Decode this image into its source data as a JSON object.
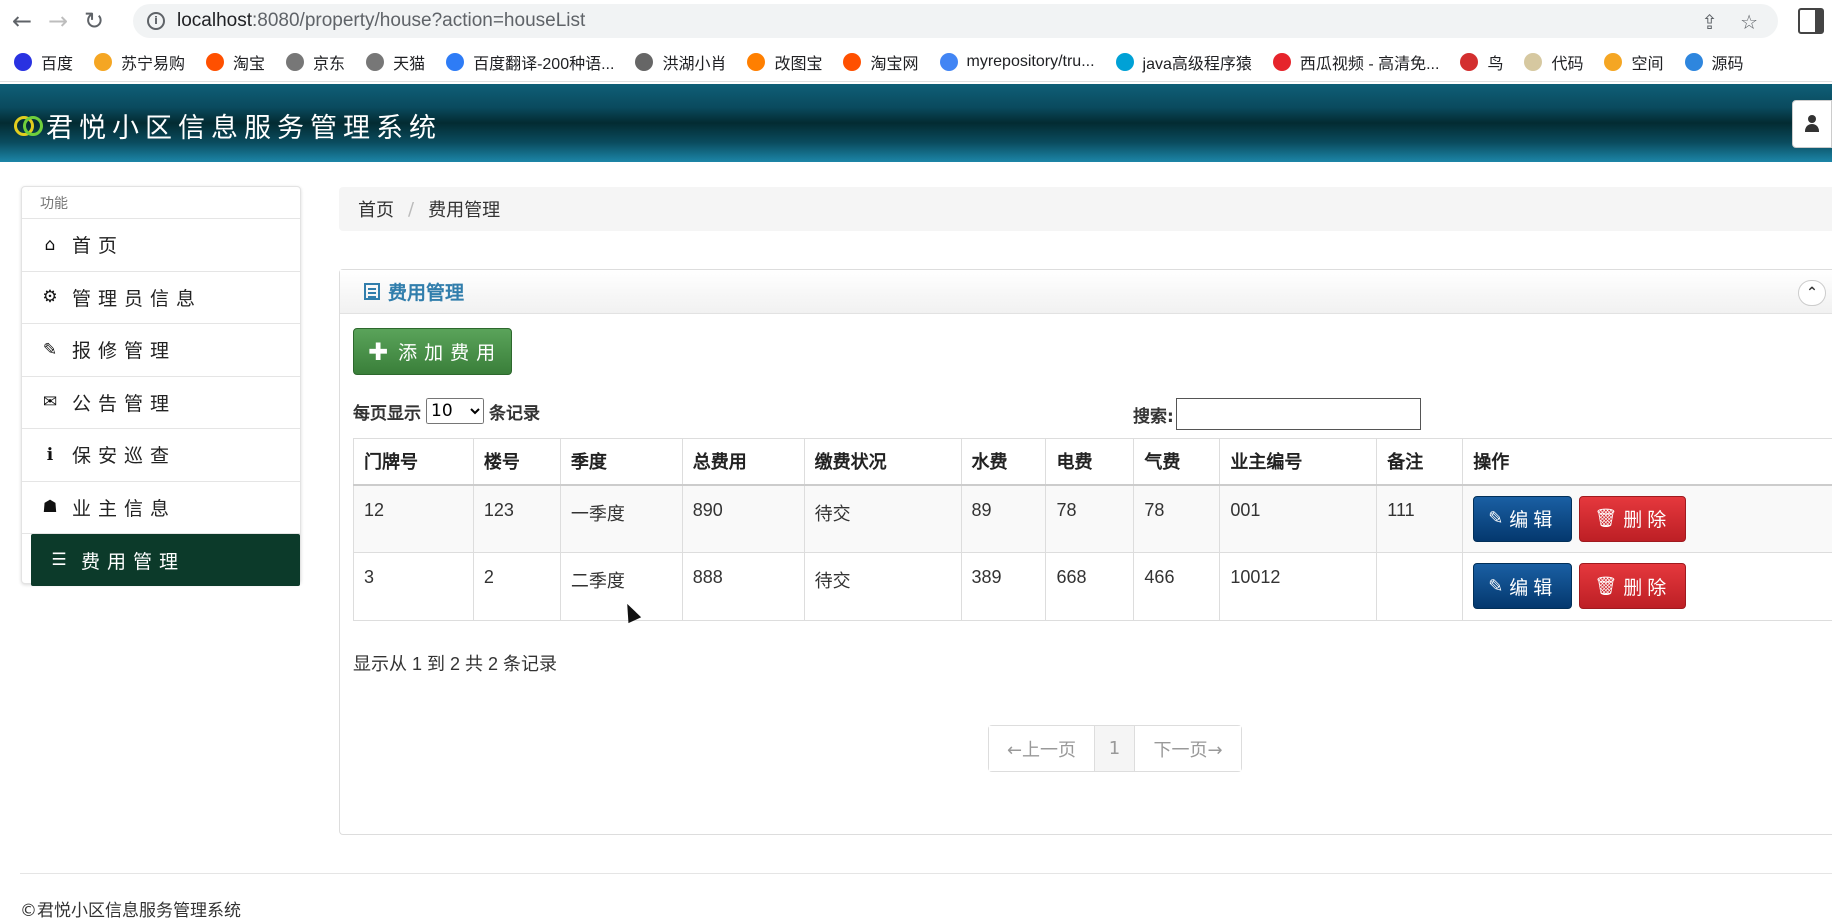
{
  "browser": {
    "url_host": "localhost",
    "url_rest": ":8080/property/house?action=houseList",
    "bookmarks": [
      {
        "label": "百度",
        "color": "#2932e1"
      },
      {
        "label": "苏宁易购",
        "color": "#f5a623"
      },
      {
        "label": "淘宝",
        "color": "#ff5000"
      },
      {
        "label": "京东",
        "color": "#777777"
      },
      {
        "label": "天猫",
        "color": "#777777"
      },
      {
        "label": "百度翻译-200种语...",
        "color": "#2e7cf6"
      },
      {
        "label": "洪湖小肖",
        "color": "#666666"
      },
      {
        "label": "改图宝",
        "color": "#ff7f00"
      },
      {
        "label": "淘宝网",
        "color": "#ff5000"
      },
      {
        "label": "myrepository/tru...",
        "color": "#4285f4"
      },
      {
        "label": "java高级程序猿",
        "color": "#00a1d6"
      },
      {
        "label": "西瓜视频 - 高清免...",
        "color": "#e6242b"
      },
      {
        "label": "鸟",
        "color": "#d32f2f"
      },
      {
        "label": "代码",
        "color": "#d6c8a0"
      },
      {
        "label": "空间",
        "color": "#f5a623"
      },
      {
        "label": "源码",
        "color": "#2e86de"
      }
    ]
  },
  "app": {
    "title": "君悦小区信息服务管理系统"
  },
  "sidebar": {
    "header": "功能",
    "items": [
      {
        "label": "首页",
        "icon": "home-icon",
        "glyph": "⌂"
      },
      {
        "label": "管理员信息",
        "icon": "gear-icon",
        "glyph": "⚙"
      },
      {
        "label": "报修管理",
        "icon": "wrench-icon",
        "glyph": "✎"
      },
      {
        "label": "公告管理",
        "icon": "envelope-icon",
        "glyph": "✉"
      },
      {
        "label": "保安巡查",
        "icon": "info-icon",
        "glyph": "ℹ"
      },
      {
        "label": "业主信息",
        "icon": "user-icon",
        "glyph": "☗"
      },
      {
        "label": "费用管理",
        "icon": "list-icon",
        "glyph": "☰"
      }
    ]
  },
  "breadcrumb": {
    "home": "首页",
    "sep": "/",
    "current": "费用管理"
  },
  "panel": {
    "title": "费用管理",
    "collapse_glyph": "⌃",
    "add_label": "添加费用",
    "length_prefix": "每页显示",
    "length_value": "10",
    "length_suffix": "条记录",
    "search_label": "搜索:",
    "search_value": "",
    "info": "显示从 1 到 2 共 2 条记录",
    "prev": "←上一页",
    "page": "1",
    "next": "下一页→"
  },
  "table": {
    "columns": [
      "门牌号",
      "楼号",
      "季度",
      "总费用",
      "缴费状况",
      "水费",
      "电费",
      "气费",
      "业主编号",
      "备注",
      "操作"
    ],
    "rows": [
      [
        "12",
        "123",
        "一季度",
        "890",
        "待交",
        "89",
        "78",
        "78",
        "001",
        "111"
      ],
      [
        "3",
        "2",
        "二季度",
        "888",
        "待交",
        "389",
        "668",
        "466",
        "10012",
        ""
      ]
    ],
    "edit_label": "编辑",
    "delete_label": "删除"
  },
  "footer": {
    "text": "©君悦小区信息服务管理系统"
  }
}
